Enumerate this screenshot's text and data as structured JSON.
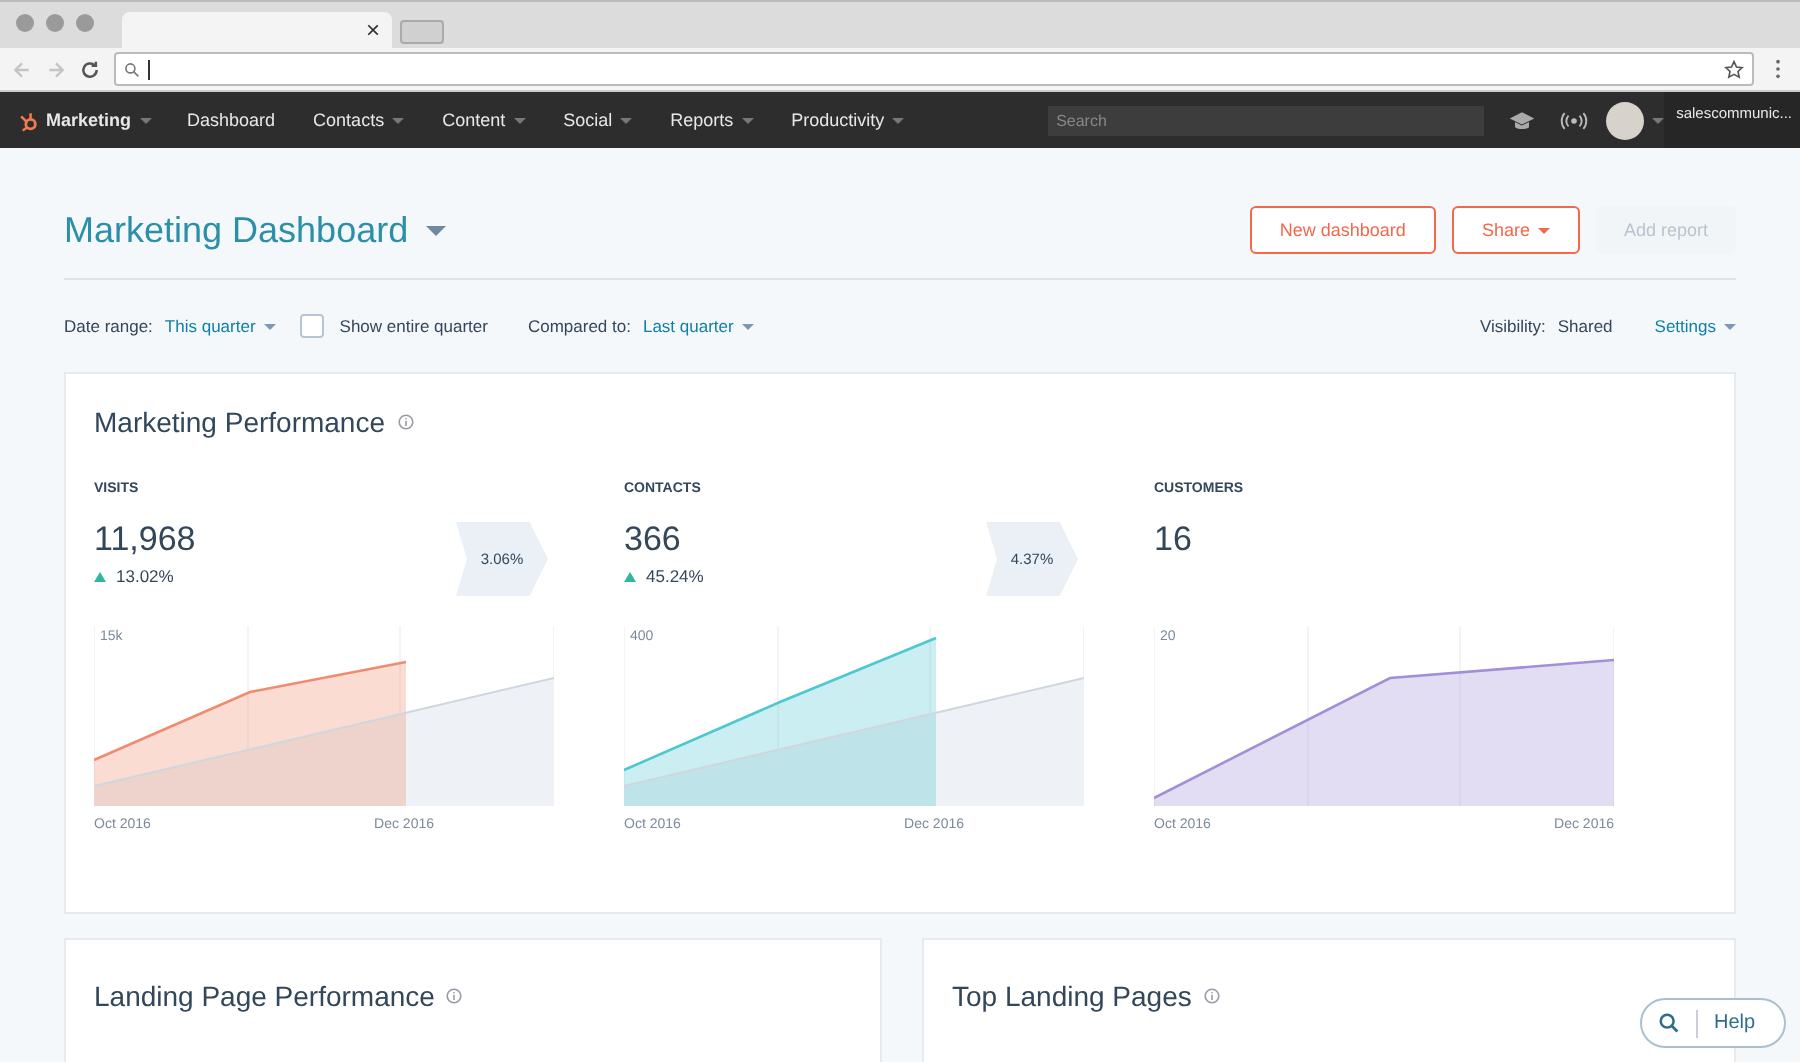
{
  "browser": {
    "tab_close": "×"
  },
  "nav": {
    "brand": "Marketing",
    "items": [
      {
        "label": "Dashboard",
        "dropdown": false
      },
      {
        "label": "Contacts",
        "dropdown": true
      },
      {
        "label": "Content",
        "dropdown": true
      },
      {
        "label": "Social",
        "dropdown": true
      },
      {
        "label": "Reports",
        "dropdown": true
      },
      {
        "label": "Productivity",
        "dropdown": true
      }
    ],
    "search": {
      "placeholder": "Search"
    },
    "account": "salescommunic..."
  },
  "header": {
    "title": "Marketing Dashboard",
    "buttons": [
      {
        "label": "New dashboard",
        "kind": "outline",
        "dropdown": false,
        "disabled": false
      },
      {
        "label": "Share",
        "kind": "outline",
        "dropdown": true,
        "disabled": false
      },
      {
        "label": "Add report",
        "kind": "plain",
        "dropdown": false,
        "disabled": true
      }
    ]
  },
  "filters": {
    "date_range": {
      "label": "Date range:",
      "value": "This quarter"
    },
    "show_entire_quarter": {
      "label": "Show entire quarter",
      "checked": false
    },
    "compared_to": {
      "label": "Compared to:",
      "value": "Last quarter"
    },
    "visibility": {
      "label": "Visibility:",
      "value": "Shared"
    },
    "settings": "Settings"
  },
  "performance": {
    "title": "Marketing Performance",
    "metrics": [
      {
        "label": "VISITS",
        "value": "11,968",
        "change": "13.02%",
        "conversion": "3.06%",
        "y_tick": "15k",
        "x_start": "Oct 2016",
        "x_end": "Dec 2016",
        "color": "#f08c6e",
        "comparison": true
      },
      {
        "label": "CONTACTS",
        "value": "366",
        "change": "45.24%",
        "conversion": "4.37%",
        "y_tick": "400",
        "x_start": "Oct 2016",
        "x_end": "Dec 2016",
        "color": "#4fc7cf",
        "comparison": true
      },
      {
        "label": "CUSTOMERS",
        "value": "16",
        "y_tick": "20",
        "x_start": "Oct 2016",
        "x_end": "Dec 2016",
        "color": "#a38fd8",
        "comparison": false
      }
    ]
  },
  "bottom_cards": [
    {
      "title": "Landing Page Performance"
    },
    {
      "title": "Top Landing Pages"
    }
  ],
  "help": {
    "label": "Help"
  }
}
